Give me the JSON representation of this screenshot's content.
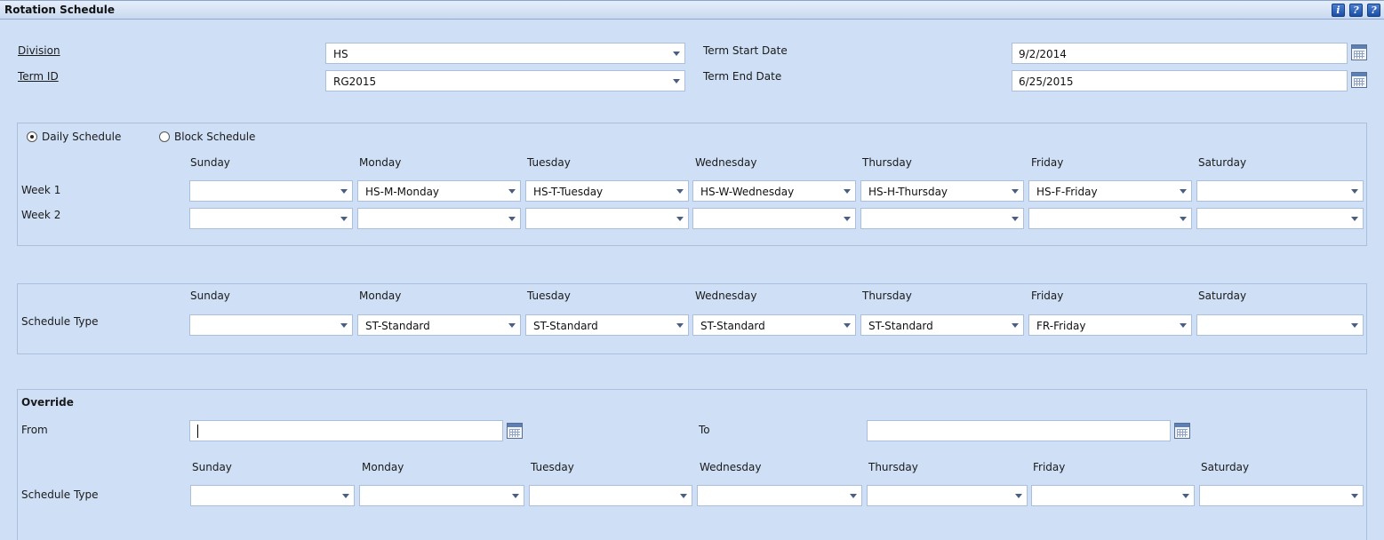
{
  "window": {
    "title": "Rotation Schedule",
    "icons": [
      "info-icon",
      "help-icon",
      "question-icon"
    ]
  },
  "header": {
    "division_label": "Division",
    "division_value": "HS",
    "term_id_label": "Term ID",
    "term_id_value": "RG2015",
    "term_start_label": "Term Start Date",
    "term_start_value": "9/2/2014",
    "term_end_label": "Term End Date",
    "term_end_value": "6/25/2015"
  },
  "days": [
    "Sunday",
    "Monday",
    "Tuesday",
    "Wednesday",
    "Thursday",
    "Friday",
    "Saturday"
  ],
  "rotation": {
    "daily_label": "Daily Schedule",
    "block_label": "Block Schedule",
    "selected": "daily",
    "weeks": [
      {
        "label": "Week 1",
        "values": [
          "",
          "HS-M-Monday",
          "HS-T-Tuesday",
          "HS-W-Wednesday",
          "HS-H-Thursday",
          "HS-F-Friday",
          ""
        ]
      },
      {
        "label": "Week 2",
        "values": [
          "",
          "",
          "",
          "",
          "",
          "",
          ""
        ]
      }
    ]
  },
  "schedule_type": {
    "label": "Schedule Type",
    "values": [
      "",
      "ST-Standard",
      "ST-Standard",
      "ST-Standard",
      "ST-Standard",
      "FR-Friday",
      ""
    ]
  },
  "override": {
    "heading": "Override",
    "from_label": "From",
    "from_value": "",
    "to_label": "To",
    "to_value": "",
    "schedule_type_label": "Schedule Type",
    "values": [
      "",
      "",
      "",
      "",
      "",
      "",
      ""
    ]
  }
}
